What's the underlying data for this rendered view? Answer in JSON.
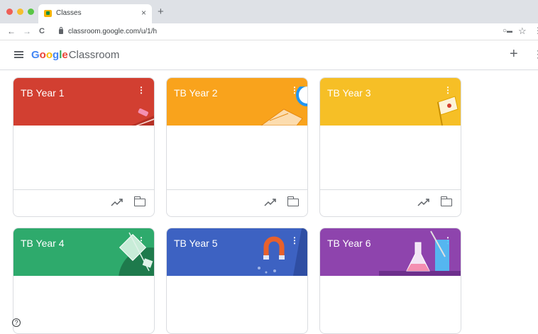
{
  "browser": {
    "tab_title": "Classes",
    "tab_close": "×",
    "new_tab": "+",
    "url": "classroom.google.com/u/1/h",
    "back": "←",
    "forward": "→",
    "reload": "C"
  },
  "app": {
    "logo_google": [
      "G",
      "o",
      "o",
      "g",
      "l",
      "e"
    ],
    "logo_product": "Classroom",
    "add_label": "+",
    "menu_label": "⋮"
  },
  "colors": {
    "logo": [
      "#4285f4",
      "#ea4335",
      "#fbbc05",
      "#4285f4",
      "#34a853",
      "#ea4335"
    ],
    "red": "#d23f31",
    "orange": "#f9a31c",
    "yellow": "#f6bf26",
    "green": "#2eaa6c",
    "blue": "#3d62c2",
    "purple": "#8e44ad"
  },
  "classes": [
    {
      "name": "TB Year 1",
      "color": "#d23f31",
      "theme": "red"
    },
    {
      "name": "TB Year 2",
      "color": "#f9a31c",
      "theme": "orange"
    },
    {
      "name": "TB Year 3",
      "color": "#f6bf26",
      "theme": "yellow"
    },
    {
      "name": "TB Year 4",
      "color": "#2eaa6c",
      "theme": "green"
    },
    {
      "name": "TB Year 5",
      "color": "#3d62c2",
      "theme": "blue"
    },
    {
      "name": "TB Year 6",
      "color": "#8e44ad",
      "theme": "purple"
    }
  ],
  "card_menu": "⋮",
  "help_label": "?"
}
